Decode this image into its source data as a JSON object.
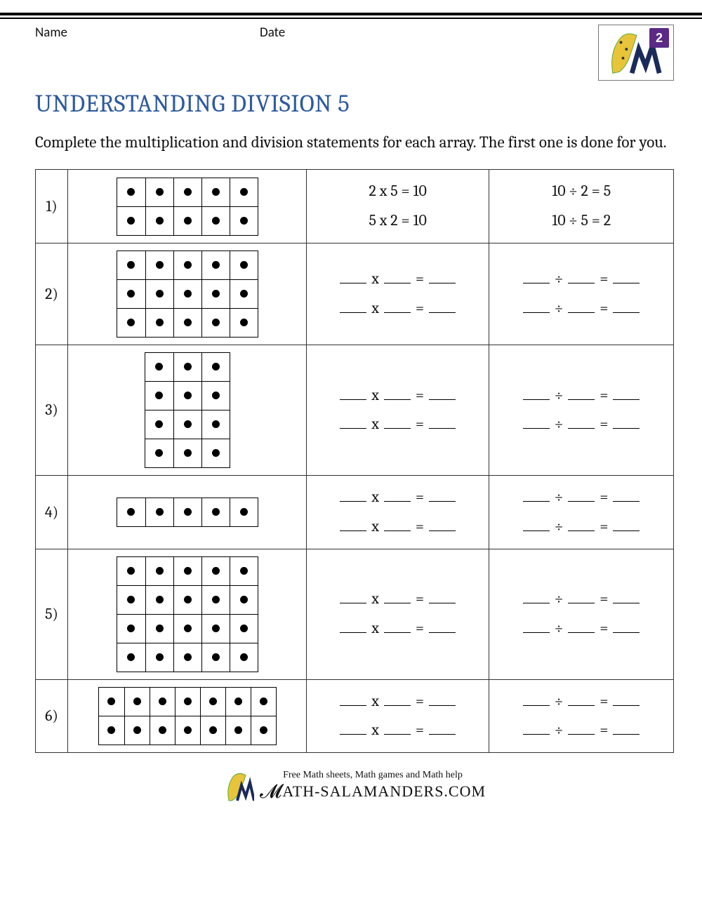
{
  "header": {
    "name_label": "Name",
    "date_label": "Date",
    "grade_badge": "2"
  },
  "title": "UNDERSTANDING DIVISION 5",
  "instructions": "Complete the multiplication and division statements for each array. The first one is done for you.",
  "blank_x": "___ x ___ = ___",
  "blank_div": "___ ÷ ___ = ___",
  "problems": [
    {
      "num": "1)",
      "rows": 2,
      "cols": 5,
      "mult": [
        "2 x 5 = 10",
        "5 x 2 = 10"
      ],
      "div": [
        "10 ÷ 2 = 5",
        "10 ÷ 5 = 2"
      ]
    },
    {
      "num": "2)",
      "rows": 3,
      "cols": 5,
      "mult": [
        "blank",
        "blank"
      ],
      "div": [
        "blank",
        "blank"
      ]
    },
    {
      "num": "3)",
      "rows": 4,
      "cols": 3,
      "mult": [
        "blank",
        "blank"
      ],
      "div": [
        "blank",
        "blank"
      ]
    },
    {
      "num": "4)",
      "rows": 1,
      "cols": 5,
      "mult": [
        "blank",
        "blank"
      ],
      "div": [
        "blank",
        "blank"
      ]
    },
    {
      "num": "5)",
      "rows": 4,
      "cols": 5,
      "mult": [
        "blank",
        "blank"
      ],
      "div": [
        "blank",
        "blank"
      ]
    },
    {
      "num": "6)",
      "rows": 2,
      "cols": 7,
      "mult": [
        "blank",
        "blank"
      ],
      "div": [
        "blank",
        "blank"
      ]
    }
  ],
  "footer": {
    "tagline": "Free Math sheets, Math games and Math help",
    "site": "ATH-SALAMANDERS.COM"
  }
}
